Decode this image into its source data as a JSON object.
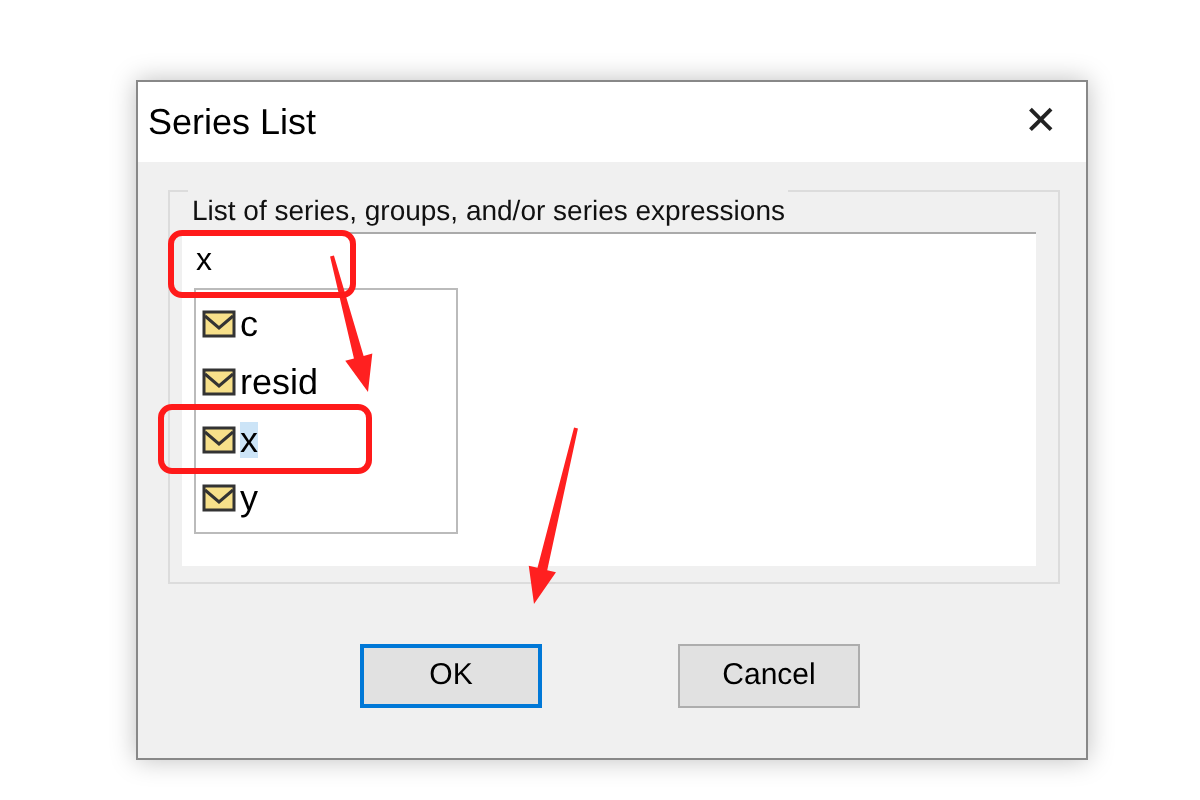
{
  "window": {
    "title": "Series List",
    "close": "✕"
  },
  "group": {
    "label": "List of series, groups, and/or series expressions",
    "input": {
      "value": "x",
      "annotated": true
    },
    "suggestions": [
      {
        "label": "c",
        "selected": false,
        "annotated": false
      },
      {
        "label": "resid",
        "selected": false,
        "annotated": false
      },
      {
        "label": "x",
        "selected": true,
        "annotated": true
      },
      {
        "label": "y",
        "selected": false,
        "annotated": false
      }
    ]
  },
  "buttons": [
    {
      "label": "OK",
      "default": true
    },
    {
      "label": "Cancel",
      "default": false
    }
  ]
}
